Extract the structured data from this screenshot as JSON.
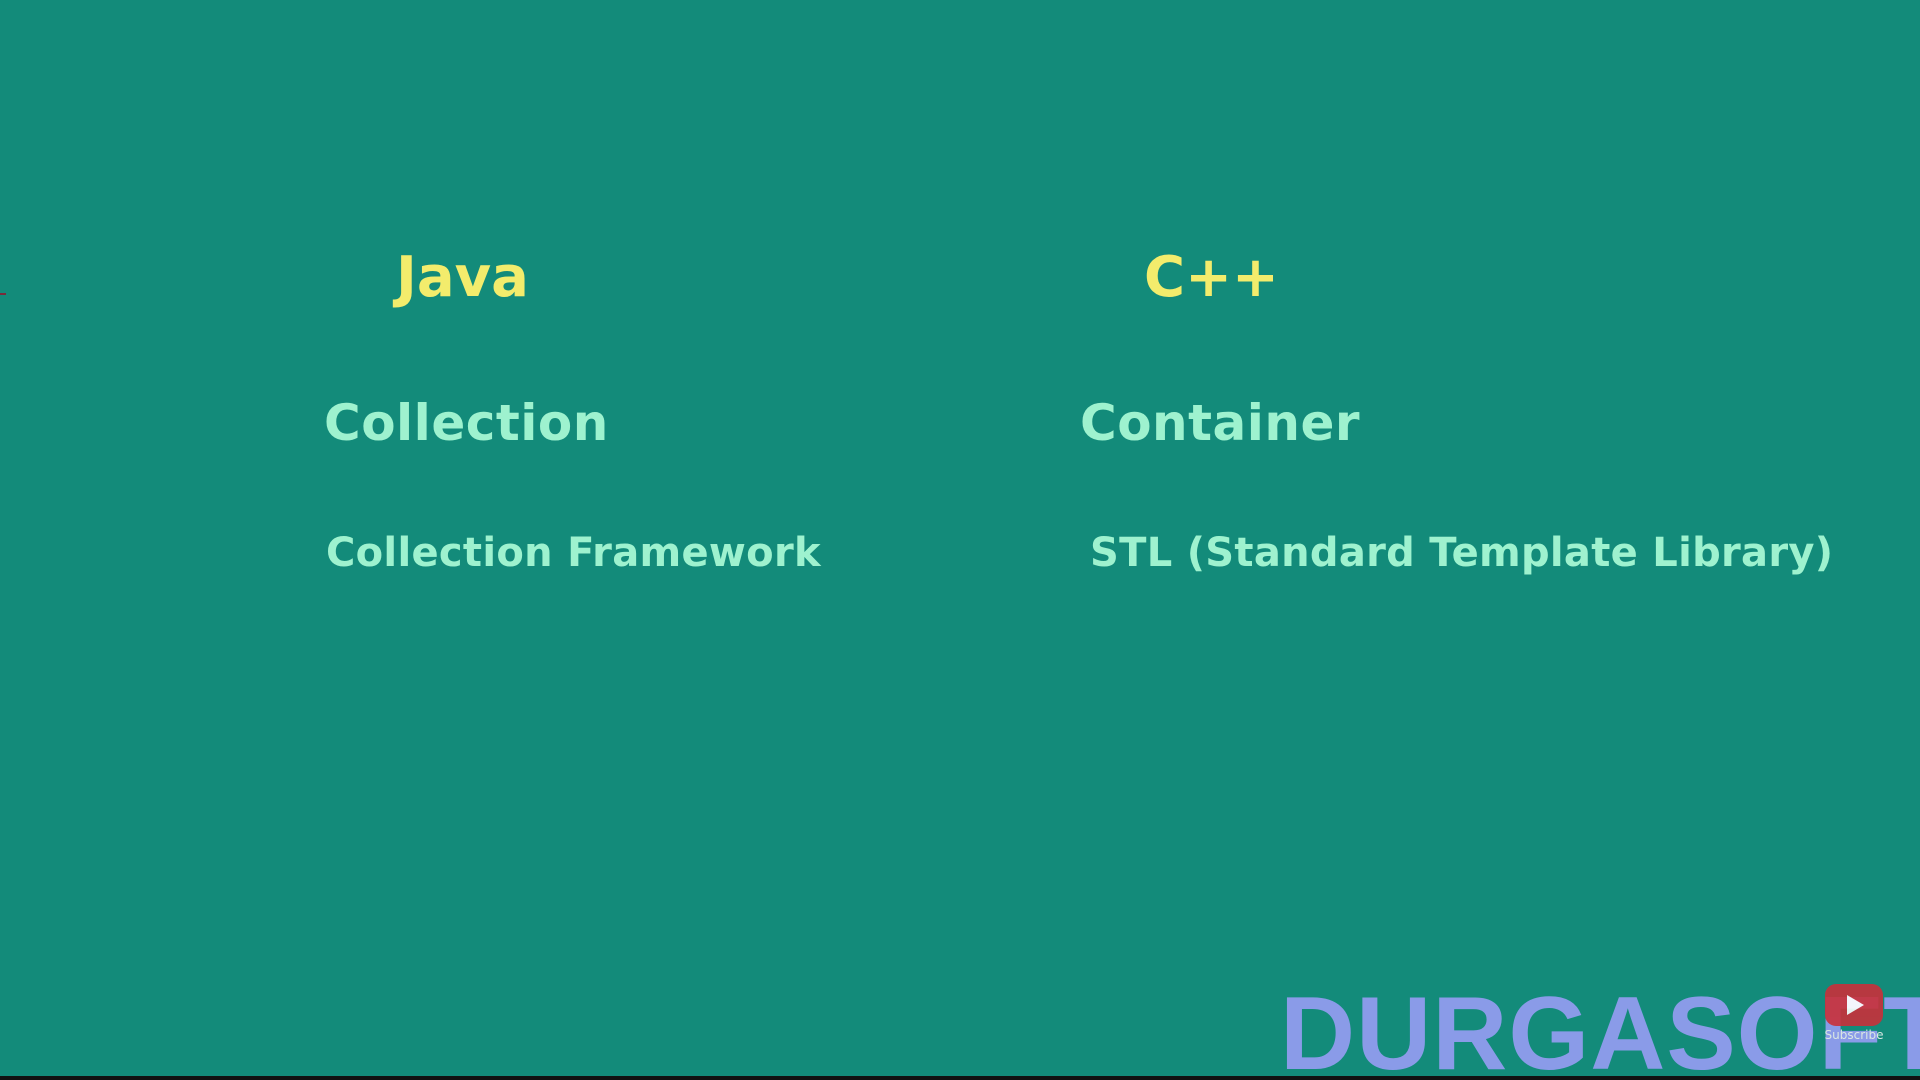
{
  "columns": {
    "java": {
      "title": "Java",
      "term": "Collection",
      "subtitle": "Collection Framework"
    },
    "cpp": {
      "title": "C++",
      "term": "Container",
      "subtitle": "STL (Standard Template Library)"
    }
  },
  "watermark": "DURGASOFT",
  "subscribe": {
    "label": "Subscribe",
    "icon": "youtube-play-icon"
  },
  "colors": {
    "background": "#138b7a",
    "title": "#f3ec6c",
    "term": "#9ef2cf",
    "watermark": "#8a9be8",
    "subscribe_button": "#c9303a"
  }
}
